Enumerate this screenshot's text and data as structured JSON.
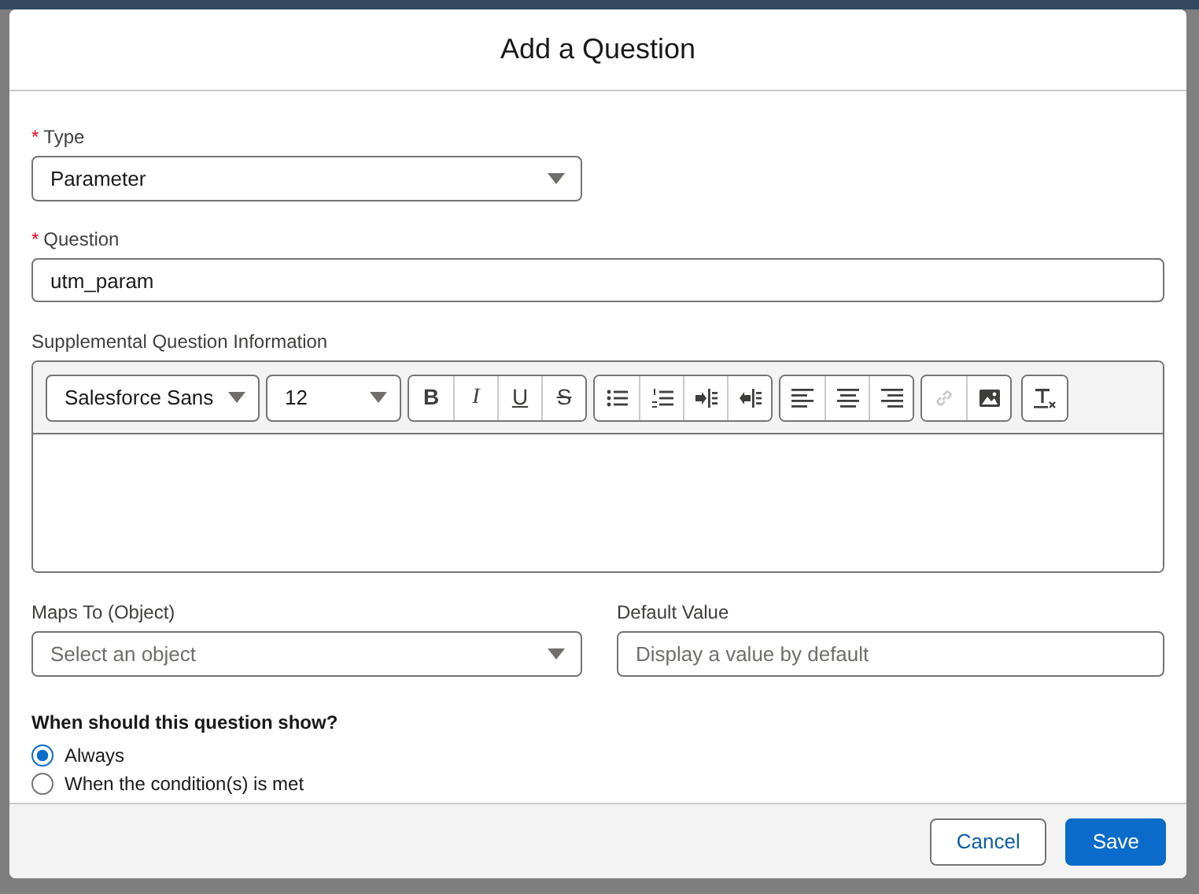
{
  "dialog": {
    "title": "Add a Question"
  },
  "type_field": {
    "marker": "*",
    "label": "Type",
    "value": "Parameter"
  },
  "question_field": {
    "marker": "*",
    "label": "Question",
    "value": "utm_param"
  },
  "supplemental": {
    "label": "Supplemental Question Information",
    "font": "Salesforce Sans",
    "size": "12",
    "toolbar": [
      [
        {
          "kind": "bold",
          "label": "B",
          "disabled": false
        },
        {
          "kind": "italic",
          "label": "I",
          "disabled": false
        },
        {
          "kind": "underline",
          "label": "U",
          "disabled": false
        },
        {
          "kind": "strike",
          "label": "S",
          "disabled": false
        }
      ],
      [
        {
          "kind": "bullets",
          "disabled": false
        },
        {
          "kind": "numbered",
          "disabled": false
        },
        {
          "kind": "indent",
          "disabled": false
        },
        {
          "kind": "outdent",
          "disabled": false
        }
      ],
      [
        {
          "kind": "align-left",
          "disabled": false
        },
        {
          "kind": "align-center",
          "disabled": false
        },
        {
          "kind": "align-right",
          "disabled": false
        }
      ],
      [
        {
          "kind": "link",
          "disabled": true
        },
        {
          "kind": "image",
          "disabled": false
        }
      ],
      [
        {
          "kind": "clear",
          "disabled": false
        }
      ]
    ]
  },
  "maps_to": {
    "label": "Maps To (Object)",
    "placeholder": "Select an object"
  },
  "default_value": {
    "label": "Default Value",
    "placeholder": "Display a value by default"
  },
  "visibility": {
    "label": "When should this question show?",
    "options": [
      {
        "label": "Always",
        "selected": true
      },
      {
        "label": "When the condition(s) is met",
        "selected": false
      }
    ]
  },
  "buttons": [
    {
      "label": "Cancel",
      "kind": "neutral"
    },
    {
      "label": "Save",
      "kind": "brand"
    }
  ]
}
